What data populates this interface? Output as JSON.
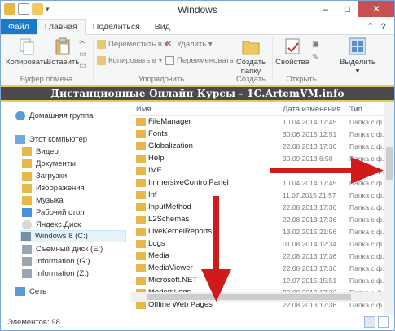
{
  "window": {
    "title": "Windows"
  },
  "tabs": [
    "Файл",
    "Главная",
    "Поделиться",
    "Вид"
  ],
  "ribbon": {
    "clipboard": {
      "copy": "Копировать",
      "paste": "Вставить",
      "group": "Буфер обмена"
    },
    "organize": {
      "move": "Переместить в ▾",
      "copy_to": "Копировать в ▾",
      "delete": "Удалить ▾",
      "rename": "Переименовать",
      "group": "Упорядочить"
    },
    "create": {
      "new_folder_1": "Создать",
      "new_folder_2": "папку",
      "group": "Создать"
    },
    "open": {
      "properties": "Свойства",
      "group": "Открыть"
    },
    "select": {
      "select": "Выделить"
    }
  },
  "banner": "Дистанционные Онлайн Курсы - 1C.ArtemVM.info",
  "nav": {
    "homegroup": "Домашняя группа",
    "this_pc": "Этот компьютер",
    "items": [
      "Видео",
      "Документы",
      "Загрузки",
      "Изображения",
      "Музыка",
      "Рабочий стол",
      "Яндекс.Диск",
      "Windows 8 (C:)",
      "Съемный диск (E:)",
      "Information (G:)",
      "Information (Z:)"
    ],
    "network": "Сеть"
  },
  "columns": {
    "name": "Имя",
    "date": "Дата изменения",
    "type": "Тип"
  },
  "files": [
    {
      "name": "FileManager",
      "date": "10.04.2014 17:45",
      "type": "Папка с ф."
    },
    {
      "name": "Fonts",
      "date": "30.06.2015 12:51",
      "type": "Папка с ф."
    },
    {
      "name": "Globalization",
      "date": "22.08.2013 17:36",
      "type": "Папка с ф."
    },
    {
      "name": "Help",
      "date": "30.09.2013 6:58",
      "type": "Папка с ф."
    },
    {
      "name": "IME",
      "date": "10.09.2013 6:58",
      "type": "Папка с ф."
    },
    {
      "name": "ImmersiveControlPanel",
      "date": "10.04.2014 17:45",
      "type": "Папка с ф."
    },
    {
      "name": "Inf",
      "date": "11.07.2015 21:57",
      "type": "Папка с ф."
    },
    {
      "name": "InputMethod",
      "date": "22.08.2013 17:36",
      "type": "Папка с ф."
    },
    {
      "name": "L2Schemas",
      "date": "22.08.2013 17:36",
      "type": "Папка с ф."
    },
    {
      "name": "LiveKernelReports",
      "date": "13.02.2015 21:56",
      "type": "Папка с ф."
    },
    {
      "name": "Logs",
      "date": "01.08.2014 12:34",
      "type": "Папка с ф."
    },
    {
      "name": "Media",
      "date": "22.08.2013 17:36",
      "type": "Папка с ф."
    },
    {
      "name": "MediaViewer",
      "date": "22.08.2013 17:36",
      "type": "Папка с ф."
    },
    {
      "name": "Microsoft.NET",
      "date": "12.07.2015 15:51",
      "type": "Папка с ф."
    },
    {
      "name": "ModemLogs",
      "date": "22.08.2013 17:36",
      "type": "Папка с ф."
    },
    {
      "name": "Offline Web Pages",
      "date": "22.08.2013 17:36",
      "type": "Папка с ф."
    }
  ],
  "status": {
    "count": "Элементов: 98"
  },
  "colors": {
    "accent": "#1979ca",
    "arrow": "#d11a1a",
    "folder": "#e8b74a",
    "banner_border": "#e8c95a"
  }
}
